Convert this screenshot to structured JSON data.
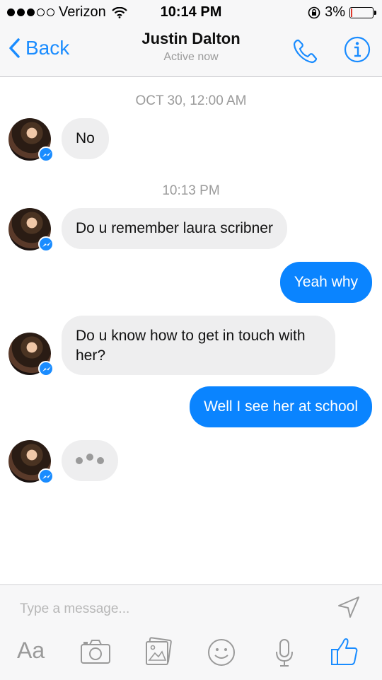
{
  "status_bar": {
    "carrier": "Verizon",
    "time": "10:14 PM",
    "battery": "3%",
    "battery_level": 0.03,
    "signal_bars": 3,
    "signal_total": 5
  },
  "nav": {
    "back_label": "Back",
    "title": "Justin Dalton",
    "subtitle": "Active now",
    "icons": [
      "phone-icon",
      "info-icon"
    ],
    "accent": "#1a8cff"
  },
  "messages": {
    "timestamps": [
      "OCT 30, 12:00 AM",
      "10:13 PM"
    ],
    "items": [
      {
        "from": "contact",
        "text": "No"
      },
      {
        "from": "contact",
        "text": "Do u remember laura scribner"
      },
      {
        "from": "me",
        "text": "Yeah why"
      },
      {
        "from": "contact",
        "text": "Do u know how to get in touch with her?"
      },
      {
        "from": "me",
        "text": "Well I see her at school"
      }
    ],
    "typing_indicator": true,
    "incoming_color": "#eeeeef",
    "outgoing_color": "#0a84ff"
  },
  "composer": {
    "placeholder": "Type a message...",
    "text_tool_label": "Aa",
    "tools": [
      "camera-icon",
      "gallery-icon",
      "emoji-icon",
      "microphone-icon",
      "thumbs-up-icon"
    ]
  }
}
